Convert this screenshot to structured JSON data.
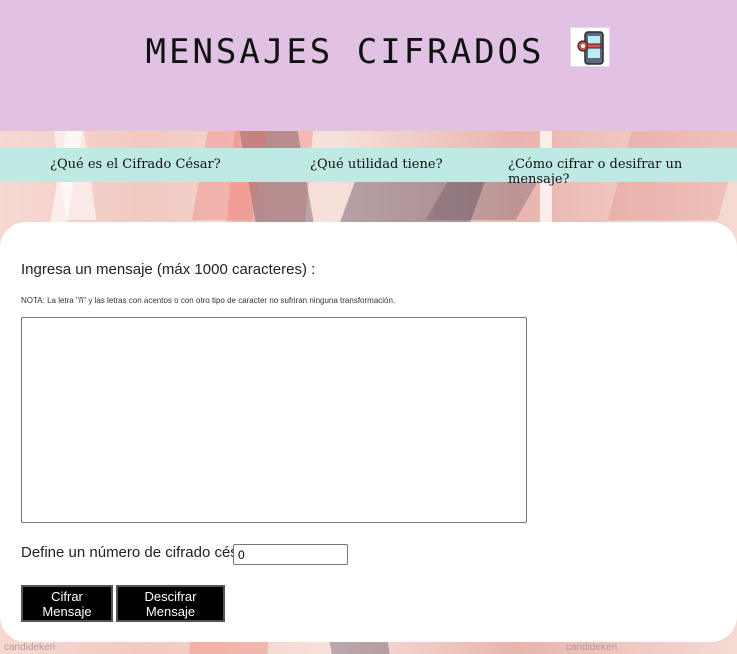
{
  "header": {
    "title": "MENSAJES CIFRADOS",
    "logo_icon": "phone-key-icon"
  },
  "nav": {
    "items": [
      {
        "label": "¿Qué es el Cifrado César?"
      },
      {
        "label": "¿Qué utilidad tiene?"
      },
      {
        "label": "¿Cómo cifrar o desifrar un mensaje?"
      }
    ]
  },
  "form": {
    "message_label": "Ingresa un mensaje (máx 1000 caracteres) :",
    "note": "NOTA: La letra \"ñ\" y las letras con acentos o con otro tipo de caracter no sufriran ninguna transformación.",
    "message_value": "",
    "shift_label": "Define un número de cifrado césar",
    "shift_value": "0",
    "encrypt_label": "Cifrar Mensaje",
    "decrypt_label": "Descifrar Mensaje"
  },
  "footer": {
    "watermark": "candidekeri"
  },
  "colors": {
    "header_bg": "#e1c2e4",
    "nav_bg": "#bfe9e3",
    "button_bg": "#000000"
  }
}
